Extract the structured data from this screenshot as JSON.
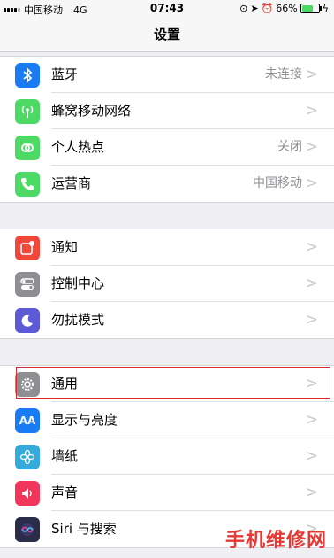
{
  "status_bar": {
    "carrier": "中国移动",
    "network": "4G",
    "time": "07:43",
    "battery": "66%",
    "battery_level": 0.66
  },
  "nav": {
    "title": "设置"
  },
  "groups": [
    {
      "items": [
        {
          "label": "蓝牙",
          "value": "未连接",
          "icon": "bluetooth-icon",
          "color": "#1a7cf4"
        },
        {
          "label": "蜂窝移动网络",
          "value": "",
          "icon": "cellular-icon",
          "color": "#4cd964"
        },
        {
          "label": "个人热点",
          "value": "关闭",
          "icon": "hotspot-icon",
          "color": "#4cd964"
        },
        {
          "label": "运营商",
          "value": "中国移动",
          "icon": "phone-icon",
          "color": "#4cd964"
        }
      ]
    },
    {
      "items": [
        {
          "label": "通知",
          "value": "",
          "icon": "notifications-icon",
          "color": "#f2463b"
        },
        {
          "label": "控制中心",
          "value": "",
          "icon": "control-center-icon",
          "color": "#8e8e93"
        },
        {
          "label": "勿扰模式",
          "value": "",
          "icon": "moon-icon",
          "color": "#5c5ad6"
        }
      ]
    },
    {
      "items": [
        {
          "label": "通用",
          "value": "",
          "icon": "gear-icon",
          "color": "#8e8e93"
        },
        {
          "label": "显示与亮度",
          "value": "",
          "icon": "display-icon",
          "color": "#1a7cf4",
          "icon_text": "AA"
        },
        {
          "label": "墙纸",
          "value": "",
          "icon": "wallpaper-icon",
          "color": "#35aadc"
        },
        {
          "label": "声音",
          "value": "",
          "icon": "sound-icon",
          "color": "#f2355b"
        },
        {
          "label": "Siri 与搜索",
          "value": "",
          "icon": "siri-icon",
          "color": "#2b2b4a"
        }
      ]
    }
  ],
  "watermark": "手机维修网"
}
